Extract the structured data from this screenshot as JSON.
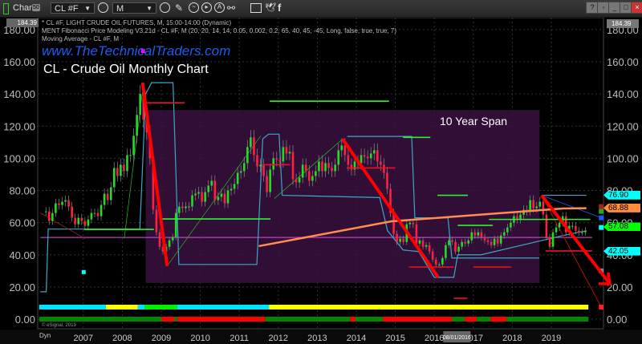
{
  "toolbar": {
    "app_label": "Chart",
    "app_badge": "50",
    "symbol": "CL #F",
    "interval": "M",
    "icons": [
      "link-chain-icon",
      "refresh-clock-icon",
      "pencil-icon",
      "trend-icon",
      "play-icon",
      "alert-icon",
      "link-icon",
      "comment-icon",
      "twitter-icon",
      "facebook-icon"
    ],
    "window_buttons": [
      "?",
      "▫",
      "_",
      "□",
      "×"
    ]
  },
  "legend": {
    "line1": "* CL #F, LIGHT CRUDE OIL FUTURES, M, 15:00-14:00 (Dynamic)",
    "line2": "MENT Fibonacci Price Modeling V3.21d - CL #F, M (20, 20, 14, 14, 0.05, 0.002, 0.2, 65, 40, 45, -45, Long, false, true, true, 7)",
    "line3": "Moving Average - CL #F, M"
  },
  "overlay_text": {
    "website": "www.TheTechnicalTraders.com",
    "title": "CL - Crude Oil Monthly Chart",
    "span_label": "10 Year Span",
    "copyright": "© eSignal, 2019",
    "dyn": "Dyn"
  },
  "axis": {
    "top_value": "184.39",
    "cursor_date": "08/01/2016"
  },
  "price_labels": [
    {
      "value": "76.90",
      "color": "#00ffff"
    },
    {
      "value": "68.88",
      "color": "#ff8c40"
    },
    {
      "value": "57.08",
      "color": "#00ff00"
    },
    {
      "value": "42.05",
      "color": "#00ffff"
    }
  ],
  "chart_data": {
    "type": "candlestick",
    "title": "CL - Crude Oil Monthly Chart",
    "symbol": "CL #F",
    "start_month": "2006-01",
    "closes": [
      67,
      61,
      66,
      72,
      71,
      73,
      74,
      70,
      63,
      59,
      63,
      61,
      58,
      62,
      66,
      66,
      64,
      71,
      78,
      74,
      82,
      94,
      89,
      96,
      92,
      102,
      102,
      114,
      127,
      140,
      124,
      116,
      100,
      68,
      54,
      45,
      42,
      45,
      49,
      51,
      66,
      70,
      69,
      70,
      70,
      77,
      78,
      79,
      73,
      79,
      83,
      86,
      74,
      76,
      78,
      72,
      80,
      81,
      84,
      91,
      92,
      97,
      107,
      113,
      102,
      95,
      96,
      89,
      79,
      93,
      100,
      99,
      98,
      107,
      103,
      104,
      87,
      85,
      88,
      96,
      92,
      86,
      89,
      92,
      98,
      92,
      97,
      94,
      92,
      96,
      105,
      108,
      102,
      96,
      93,
      98,
      97,
      102,
      101,
      100,
      103,
      105,
      98,
      96,
      91,
      81,
      66,
      53,
      48,
      50,
      48,
      59,
      60,
      59,
      47,
      49,
      45,
      46,
      42,
      37,
      34,
      34,
      38,
      46,
      49,
      48,
      42,
      45,
      48,
      47,
      49,
      54,
      52,
      54,
      51,
      49,
      48,
      46,
      50,
      47,
      52,
      54,
      57,
      60,
      64,
      62,
      65,
      68,
      67,
      74,
      69,
      70,
      73,
      65,
      51,
      45,
      54,
      57,
      60,
      64,
      54,
      58,
      58,
      55,
      54,
      54,
      55
    ],
    "up_color": "#22dd22",
    "down_color": "#ff2040",
    "y_ticks": [
      0,
      20,
      40,
      60,
      80,
      100,
      120,
      140,
      160,
      180
    ],
    "ylim": [
      0,
      184.39
    ],
    "x_ticks": [
      2007,
      2008,
      2009,
      2010,
      2011,
      2012,
      2013,
      2014,
      2015,
      2016,
      2017,
      2018,
      2019
    ],
    "grid": true,
    "span_box": {
      "from": 2008.6,
      "to": 2018.7,
      "low": 22.5,
      "high": 130,
      "color": "#3a1040"
    },
    "moving_average": {
      "color": "#ff8c50",
      "points": [
        [
          2011.5,
          45.4
        ],
        [
          2014.9,
          60.8
        ],
        [
          2019.3,
          68.8
        ],
        [
          2019.9,
          69
        ]
      ]
    },
    "magenta_level": {
      "price": 50.8,
      "from": 2005.9,
      "to": 2020.05,
      "color": "#c040c0"
    },
    "red_arrows": [
      {
        "from": [
          2008.52,
          147
        ],
        "to": [
          2009.15,
          33
        ]
      },
      {
        "from": [
          2013.65,
          112
        ],
        "to": [
          2016.1,
          26
        ]
      },
      {
        "from": [
          2018.75,
          77
        ],
        "to": [
          2020.5,
          22
        ],
        "head": true
      }
    ],
    "green_levels": [
      {
        "price": 135.5,
        "from": 2011.78,
        "to": 2014.84
      },
      {
        "price": 55.8,
        "from": 2007.02,
        "to": 2008.81
      },
      {
        "price": 62.3,
        "from": 2009.0,
        "to": 2011.8
      },
      {
        "price": 113,
        "from": 2015.2,
        "to": 2015.9
      },
      {
        "price": 77,
        "from": 2016.08,
        "to": 2016.86
      },
      {
        "price": 58.3,
        "from": 2016.6,
        "to": 2017.5
      },
      {
        "price": 62,
        "from": 2017.4,
        "to": 2020.0
      }
    ],
    "red_levels": [
      {
        "price": 134.5,
        "from": 2008.6,
        "to": 2009.6
      },
      {
        "price": 96,
        "from": 2011.6,
        "to": 2012.3
      },
      {
        "price": 94,
        "from": 2013.75,
        "to": 2015.0
      },
      {
        "price": 32.4,
        "from": 2015.35,
        "to": 2016.5
      },
      {
        "price": 13,
        "from": 2016.5,
        "to": 2016.85
      },
      {
        "price": 32.4,
        "from": 2017.0,
        "to": 2017.97
      },
      {
        "price": 42.4,
        "from": 2018.85,
        "to": 2020.05
      }
    ],
    "fib_lines": [
      [
        [
          2005.9,
          17
        ],
        [
          2006.05,
          17
        ],
        [
          2006.1,
          56
        ],
        [
          2008.45,
          56
        ],
        [
          2008.6,
          140
        ],
        [
          2008.75,
          147
        ],
        [
          2009.3,
          147
        ],
        [
          2009.45,
          34
        ],
        [
          2011.45,
          34
        ],
        [
          2011.6,
          112
        ],
        [
          2011.75,
          115
        ],
        [
          2012.02,
          115
        ],
        [
          2012.1,
          77
        ],
        [
          2014.6,
          75.6
        ],
        [
          2014.8,
          55
        ],
        [
          2015.2,
          43
        ],
        [
          2015.6,
          42
        ],
        [
          2016.0,
          26
        ],
        [
          2016.5,
          26
        ],
        [
          2016.6,
          40
        ],
        [
          2017.2,
          40
        ],
        [
          2019.3,
          52
        ],
        [
          2019.9,
          55
        ]
      ],
      [
        [
          2013.77,
          113.6
        ],
        [
          2015.42,
          113.6
        ],
        [
          2015.5,
          63
        ],
        [
          2016.35,
          63
        ],
        [
          2016.45,
          38
        ],
        [
          2018.69,
          38
        ]
      ],
      [
        [
          2018.75,
          77
        ],
        [
          2019.9,
          77
        ]
      ]
    ],
    "bottom_bands": {
      "upper": [
        {
          "from": 2005.87,
          "to": 2007.58,
          "color": "#00e5ff"
        },
        {
          "from": 2007.58,
          "to": 2008.4,
          "color": "#ffff00"
        },
        {
          "from": 2008.4,
          "to": 2008.57,
          "color": "#00e5ff"
        },
        {
          "from": 2008.57,
          "to": 2009.41,
          "color": "#00ee00"
        },
        {
          "from": 2009.41,
          "to": 2011.76,
          "color": "#00e5ff"
        },
        {
          "from": 2011.76,
          "to": 2019.95,
          "color": "#ffff00"
        }
      ],
      "lower": [
        {
          "from": 2005.87,
          "to": 2009.0,
          "color": "#008800"
        },
        {
          "from": 2009.0,
          "to": 2009.33,
          "color": "#ff0000"
        },
        {
          "from": 2009.33,
          "to": 2009.41,
          "color": "#008800"
        },
        {
          "from": 2009.41,
          "to": 2011.67,
          "color": "#ff0000"
        },
        {
          "from": 2011.67,
          "to": 2013.84,
          "color": "#008800"
        },
        {
          "from": 2013.84,
          "to": 2013.98,
          "color": "#ff0000"
        },
        {
          "from": 2013.98,
          "to": 2014.68,
          "color": "#008800"
        },
        {
          "from": 2014.68,
          "to": 2016.45,
          "color": "#ff0000"
        },
        {
          "from": 2016.45,
          "to": 2016.78,
          "color": "#008800"
        },
        {
          "from": 2016.78,
          "to": 2017.09,
          "color": "#ff0000"
        },
        {
          "from": 2017.09,
          "to": 2017.44,
          "color": "#008800"
        },
        {
          "from": 2017.44,
          "to": 2017.85,
          "color": "#ff0000"
        },
        {
          "from": 2017.85,
          "to": 2019.95,
          "color": "#008800"
        }
      ]
    }
  }
}
